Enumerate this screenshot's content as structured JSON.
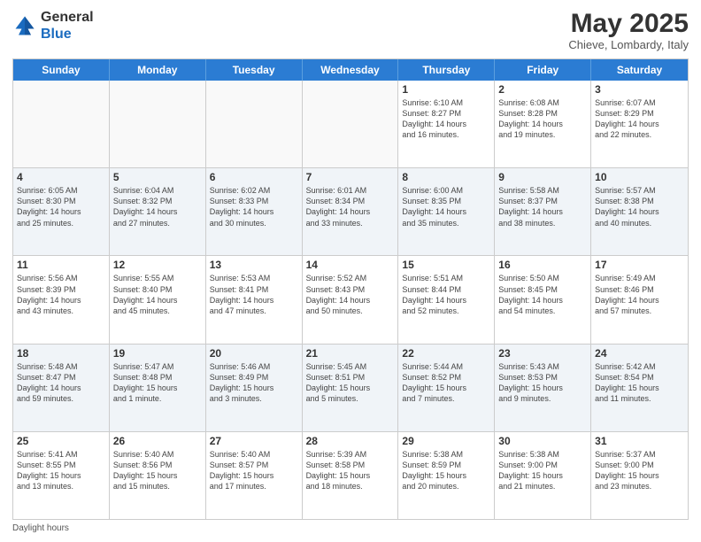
{
  "header": {
    "logo_general": "General",
    "logo_blue": "Blue",
    "month_title": "May 2025",
    "location": "Chieve, Lombardy, Italy"
  },
  "days_of_week": [
    "Sunday",
    "Monday",
    "Tuesday",
    "Wednesday",
    "Thursday",
    "Friday",
    "Saturday"
  ],
  "footer": {
    "note": "Daylight hours"
  },
  "weeks": [
    {
      "cells": [
        {
          "day": "",
          "info": "",
          "empty": true
        },
        {
          "day": "",
          "info": "",
          "empty": true
        },
        {
          "day": "",
          "info": "",
          "empty": true
        },
        {
          "day": "",
          "info": "",
          "empty": true
        },
        {
          "day": "1",
          "info": "Sunrise: 6:10 AM\nSunset: 8:27 PM\nDaylight: 14 hours\nand 16 minutes.",
          "empty": false
        },
        {
          "day": "2",
          "info": "Sunrise: 6:08 AM\nSunset: 8:28 PM\nDaylight: 14 hours\nand 19 minutes.",
          "empty": false
        },
        {
          "day": "3",
          "info": "Sunrise: 6:07 AM\nSunset: 8:29 PM\nDaylight: 14 hours\nand 22 minutes.",
          "empty": false
        }
      ]
    },
    {
      "cells": [
        {
          "day": "4",
          "info": "Sunrise: 6:05 AM\nSunset: 8:30 PM\nDaylight: 14 hours\nand 25 minutes.",
          "empty": false
        },
        {
          "day": "5",
          "info": "Sunrise: 6:04 AM\nSunset: 8:32 PM\nDaylight: 14 hours\nand 27 minutes.",
          "empty": false
        },
        {
          "day": "6",
          "info": "Sunrise: 6:02 AM\nSunset: 8:33 PM\nDaylight: 14 hours\nand 30 minutes.",
          "empty": false
        },
        {
          "day": "7",
          "info": "Sunrise: 6:01 AM\nSunset: 8:34 PM\nDaylight: 14 hours\nand 33 minutes.",
          "empty": false
        },
        {
          "day": "8",
          "info": "Sunrise: 6:00 AM\nSunset: 8:35 PM\nDaylight: 14 hours\nand 35 minutes.",
          "empty": false
        },
        {
          "day": "9",
          "info": "Sunrise: 5:58 AM\nSunset: 8:37 PM\nDaylight: 14 hours\nand 38 minutes.",
          "empty": false
        },
        {
          "day": "10",
          "info": "Sunrise: 5:57 AM\nSunset: 8:38 PM\nDaylight: 14 hours\nand 40 minutes.",
          "empty": false
        }
      ]
    },
    {
      "cells": [
        {
          "day": "11",
          "info": "Sunrise: 5:56 AM\nSunset: 8:39 PM\nDaylight: 14 hours\nand 43 minutes.",
          "empty": false
        },
        {
          "day": "12",
          "info": "Sunrise: 5:55 AM\nSunset: 8:40 PM\nDaylight: 14 hours\nand 45 minutes.",
          "empty": false
        },
        {
          "day": "13",
          "info": "Sunrise: 5:53 AM\nSunset: 8:41 PM\nDaylight: 14 hours\nand 47 minutes.",
          "empty": false
        },
        {
          "day": "14",
          "info": "Sunrise: 5:52 AM\nSunset: 8:43 PM\nDaylight: 14 hours\nand 50 minutes.",
          "empty": false
        },
        {
          "day": "15",
          "info": "Sunrise: 5:51 AM\nSunset: 8:44 PM\nDaylight: 14 hours\nand 52 minutes.",
          "empty": false
        },
        {
          "day": "16",
          "info": "Sunrise: 5:50 AM\nSunset: 8:45 PM\nDaylight: 14 hours\nand 54 minutes.",
          "empty": false
        },
        {
          "day": "17",
          "info": "Sunrise: 5:49 AM\nSunset: 8:46 PM\nDaylight: 14 hours\nand 57 minutes.",
          "empty": false
        }
      ]
    },
    {
      "cells": [
        {
          "day": "18",
          "info": "Sunrise: 5:48 AM\nSunset: 8:47 PM\nDaylight: 14 hours\nand 59 minutes.",
          "empty": false
        },
        {
          "day": "19",
          "info": "Sunrise: 5:47 AM\nSunset: 8:48 PM\nDaylight: 15 hours\nand 1 minute.",
          "empty": false
        },
        {
          "day": "20",
          "info": "Sunrise: 5:46 AM\nSunset: 8:49 PM\nDaylight: 15 hours\nand 3 minutes.",
          "empty": false
        },
        {
          "day": "21",
          "info": "Sunrise: 5:45 AM\nSunset: 8:51 PM\nDaylight: 15 hours\nand 5 minutes.",
          "empty": false
        },
        {
          "day": "22",
          "info": "Sunrise: 5:44 AM\nSunset: 8:52 PM\nDaylight: 15 hours\nand 7 minutes.",
          "empty": false
        },
        {
          "day": "23",
          "info": "Sunrise: 5:43 AM\nSunset: 8:53 PM\nDaylight: 15 hours\nand 9 minutes.",
          "empty": false
        },
        {
          "day": "24",
          "info": "Sunrise: 5:42 AM\nSunset: 8:54 PM\nDaylight: 15 hours\nand 11 minutes.",
          "empty": false
        }
      ]
    },
    {
      "cells": [
        {
          "day": "25",
          "info": "Sunrise: 5:41 AM\nSunset: 8:55 PM\nDaylight: 15 hours\nand 13 minutes.",
          "empty": false
        },
        {
          "day": "26",
          "info": "Sunrise: 5:40 AM\nSunset: 8:56 PM\nDaylight: 15 hours\nand 15 minutes.",
          "empty": false
        },
        {
          "day": "27",
          "info": "Sunrise: 5:40 AM\nSunset: 8:57 PM\nDaylight: 15 hours\nand 17 minutes.",
          "empty": false
        },
        {
          "day": "28",
          "info": "Sunrise: 5:39 AM\nSunset: 8:58 PM\nDaylight: 15 hours\nand 18 minutes.",
          "empty": false
        },
        {
          "day": "29",
          "info": "Sunrise: 5:38 AM\nSunset: 8:59 PM\nDaylight: 15 hours\nand 20 minutes.",
          "empty": false
        },
        {
          "day": "30",
          "info": "Sunrise: 5:38 AM\nSunset: 9:00 PM\nDaylight: 15 hours\nand 21 minutes.",
          "empty": false
        },
        {
          "day": "31",
          "info": "Sunrise: 5:37 AM\nSunset: 9:00 PM\nDaylight: 15 hours\nand 23 minutes.",
          "empty": false
        }
      ]
    }
  ]
}
